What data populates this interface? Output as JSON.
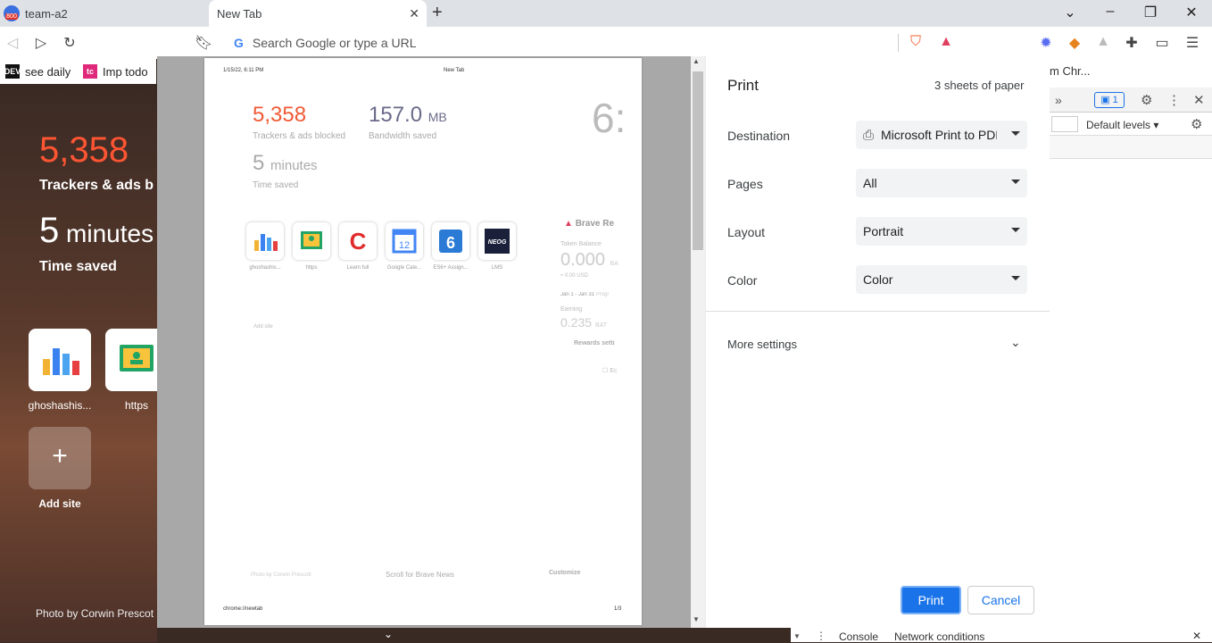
{
  "tabs": [
    {
      "title": "team-a2",
      "badge": "800"
    },
    {
      "title": "New Tab"
    }
  ],
  "omnibox": {
    "placeholder": "Search Google or type a URL"
  },
  "bookmarks": [
    {
      "label": "see daily",
      "icon": "DEV"
    },
    {
      "label": "Imp todo",
      "icon": "tc"
    }
  ],
  "background_page": {
    "trackers_count": "5,358",
    "trackers_label": "Trackers & ads b",
    "time_value": "5",
    "time_unit": "minutes",
    "time_label": "Time saved",
    "tiles": [
      {
        "name": "ghoshashis..."
      },
      {
        "name": "https"
      }
    ],
    "add_site": "Add site",
    "photo_credit": "Photo by Corwin Prescot"
  },
  "devtools": {
    "tab_label": "m Chr...",
    "issues_count": "1",
    "levels": "Default levels",
    "console_tab": "Console",
    "network_tab": "Network conditions"
  },
  "print_dialog": {
    "title": "Print",
    "sheets": "3 sheets of paper",
    "destination_label": "Destination",
    "destination_value": "Microsoft Print to PDF",
    "pages_label": "Pages",
    "pages_value": "All",
    "layout_label": "Layout",
    "layout_value": "Portrait",
    "color_label": "Color",
    "color_value": "Color",
    "more_settings": "More settings",
    "print_button": "Print",
    "cancel_button": "Cancel"
  },
  "preview": {
    "header_date": "1/15/22, 6:11 PM",
    "header_title": "New Tab",
    "trackers_count": "5,358",
    "trackers_label": "Trackers & ads blocked",
    "bandwidth_value": "157.0",
    "bandwidth_unit": "MB",
    "bandwidth_label": "Bandwidth saved",
    "time_value": "5",
    "time_unit": "minutes",
    "time_label": "Time saved",
    "clock": "6:",
    "tiles": [
      {
        "name": "ghoshashis..."
      },
      {
        "name": "https"
      },
      {
        "name": "Learn full"
      },
      {
        "name": "Google Cale..."
      },
      {
        "name": "ES6+ Assign..."
      },
      {
        "name": "LMS"
      }
    ],
    "add_site": "Add site",
    "rewards_title": "Brave Re",
    "token_label": "Token Balance",
    "token_value": "0.000",
    "token_unit": "BA",
    "usd": "≈ 0.00 USD",
    "period": "Jan 1 - Jan 31",
    "progress": "Progr",
    "earning_label": "Earning",
    "earning_value": "0.235",
    "earning_unit": "BAT",
    "rewards_settings": "Rewards setti",
    "ec": "Ec",
    "photo_credit": "Photo by Corwin Prescott",
    "scroll_news": "Scroll for Brave News",
    "customize": "Customize",
    "footer_url": "chrome://newtab",
    "footer_page": "1/3"
  },
  "colors": {
    "accent": "#1a73e8",
    "brave_orange": "#ff5533"
  }
}
